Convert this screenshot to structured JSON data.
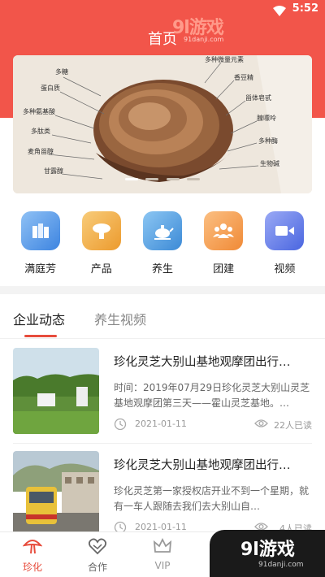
{
  "status": {
    "time": "5:52"
  },
  "header": {
    "title": "首页"
  },
  "watermark": {
    "logo": "9l游戏",
    "domain": "91danji.com"
  },
  "banner": {
    "labels_left": [
      "多糖",
      "蛋白质",
      "多种氨基酸",
      "多肽类",
      "麦角甾醇",
      "甘露醇"
    ],
    "labels_right": [
      "多种微量元素",
      "香豆精",
      "甾体皂甙",
      "腺嘌呤",
      "多种酶",
      "生物碱"
    ],
    "active_slide": 1,
    "slide_count": 4
  },
  "quick_nav": [
    {
      "label": "满庭芳",
      "icon": "book-icon",
      "color": "#4f95e6"
    },
    {
      "label": "产品",
      "icon": "product-icon",
      "color": "#f0a63b"
    },
    {
      "label": "养生",
      "icon": "teapot-icon",
      "color": "#4d9ce0"
    },
    {
      "label": "团建",
      "icon": "team-icon",
      "color": "#f49a4a"
    },
    {
      "label": "视频",
      "icon": "video-icon",
      "color": "#5a76e8"
    }
  ],
  "tabs": [
    {
      "label": "企业动态",
      "active": true
    },
    {
      "label": "养生视频",
      "active": false
    }
  ],
  "articles": [
    {
      "title": "珍化灵芝大别山基地观摩团出行…",
      "summary": "时间：2019年07月29日珍化灵芝大别山灵芝基地观摩团第三天——霍山灵芝基地。…",
      "date": "2021-01-11",
      "reads": "22人已读"
    },
    {
      "title": "珍化灵芝大别山基地观摩团出行…",
      "summary": "珍化灵芝第一家授权店开业不到一个星期，就有一车人跟随去我们去大别山自…",
      "date": "2021-01-11",
      "reads": "4人已读"
    }
  ],
  "bottom_nav": [
    {
      "label": "珍化",
      "icon": "mushroom-icon",
      "active": true
    },
    {
      "label": "合作",
      "icon": "handshake-icon",
      "active": false
    },
    {
      "label": "VIP",
      "icon": "crown-icon",
      "active": false
    }
  ],
  "colors": {
    "brand": "#f2554a",
    "accent": "#e74c3c"
  }
}
